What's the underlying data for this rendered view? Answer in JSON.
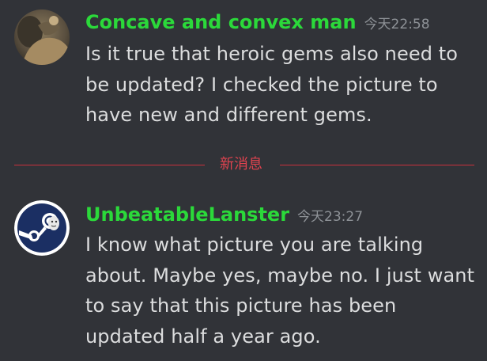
{
  "messages": [
    {
      "username": "Concave and convex man",
      "timestamp": "今天22:58",
      "username_color": "#2bd93a",
      "avatar": "photo-avatar",
      "text": "Is it true that heroic gems also need to be updated? I checked the picture to have new and different gems."
    },
    {
      "username": "UnbeatableLanster",
      "timestamp": "今天23:27",
      "username_color": "#2bd93a",
      "avatar": "steam-logo-avatar",
      "text": "I know what picture you are talking about. Maybe yes, maybe no. I just want to say that this picture has been updated half a year ago."
    }
  ],
  "divider": {
    "label": "新消息",
    "color": "#e0434f"
  },
  "theme": {
    "background": "#313338",
    "text": "#dcddde",
    "timestamp": "#8e9297"
  }
}
